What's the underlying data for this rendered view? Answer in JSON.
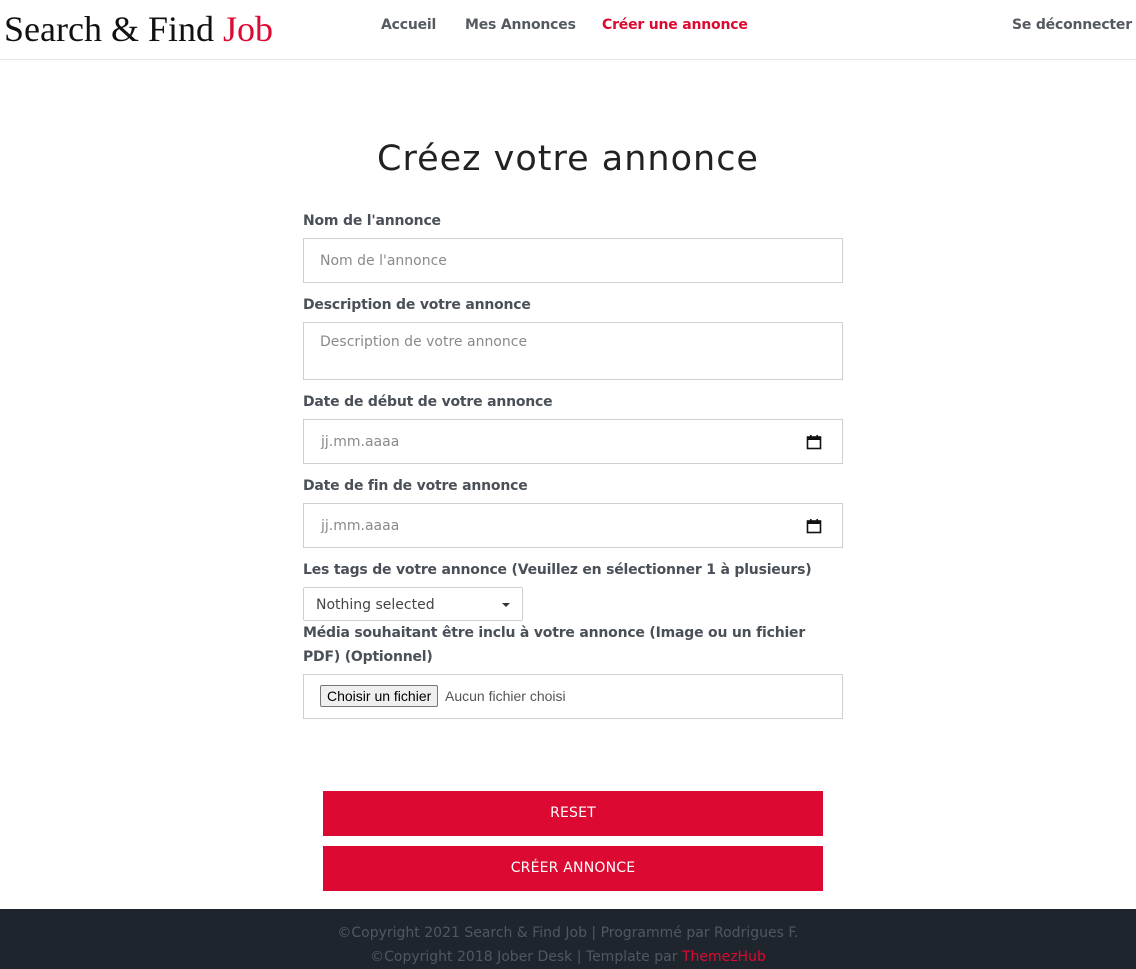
{
  "header": {
    "brand_text": "Search & Find ",
    "brand_accent": "Job",
    "nav": {
      "home": "Accueil",
      "my_ads": "Mes Annonces",
      "create_ad": "Créer une annonce",
      "logout": "Se déconnecter"
    }
  },
  "main": {
    "title": "Créez votre annonce",
    "form": {
      "name_label": "Nom de l'annonce",
      "name_placeholder": "Nom de l'annonce",
      "description_label": "Description de votre annonce",
      "description_placeholder": "Description de votre annonce",
      "start_date_label": "Date de début de votre annonce",
      "start_date_placeholder": "jj.mm.aaaa",
      "end_date_label": "Date de fin de votre annonce",
      "end_date_placeholder": "jj.mm.aaaa",
      "tags_label": "Les tags de votre annonce (Veuillez en sélectionner 1 à plusieurs)",
      "tags_selected": "Nothing selected",
      "media_label_line1": "Média souhaitant être inclu à votre annonce (Image ou un fichier",
      "media_label_line2": "PDF) (Optionnel)",
      "file_button": "Choisir un fichier",
      "file_status": "Aucun fichier choisi"
    },
    "buttons": {
      "reset": "RESET",
      "create": "CRÉER ANNONCE"
    }
  },
  "footer": {
    "line1": "©Copyright 2021 Search & Find Job | Programmé par Rodrigues F.",
    "line2_prefix": "©Copyright 2018 Jober Desk | Template par ",
    "line2_link": "ThemezHub"
  },
  "colors": {
    "accent": "#dc0a32",
    "footer_bg": "#1f252d",
    "label_text": "#4a5058"
  },
  "icons": {
    "date_picker": "calendar-icon",
    "dropdown": "caret-down-icon"
  }
}
